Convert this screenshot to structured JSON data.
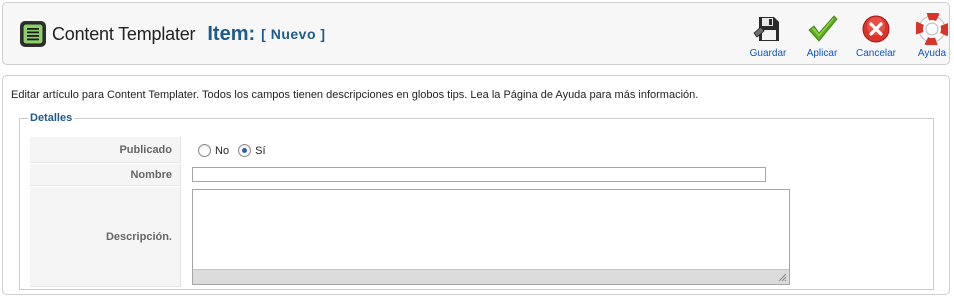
{
  "header": {
    "app_name": "Content Templater",
    "title": "Item:",
    "subtitle": "[ Nuevo ]"
  },
  "toolbar": {
    "buttons": [
      {
        "label": "Guardar",
        "icon": "save-icon"
      },
      {
        "label": "Aplicar",
        "icon": "apply-check-icon"
      },
      {
        "label": "Cancelar",
        "icon": "cancel-icon"
      },
      {
        "label": "Ayuda",
        "icon": "help-lifebuoy-icon"
      }
    ]
  },
  "intro_text": "Editar artículo para Content Templater. Todos los campos tienen descripciones en globos tips. Lea la Página de Ayuda para más información.",
  "details": {
    "legend": "Detalles",
    "published": {
      "label": "Publicado",
      "options": [
        "No",
        "Sí"
      ],
      "selected": "Sí"
    },
    "name": {
      "label": "Nombre",
      "value": ""
    },
    "description": {
      "label": "Descripción.",
      "value": ""
    }
  },
  "colors": {
    "title_blue": "#1e5b8c",
    "link_blue": "#0b55c4",
    "cancel_red": "#d9342b",
    "apply_green": "#5aa91d"
  }
}
